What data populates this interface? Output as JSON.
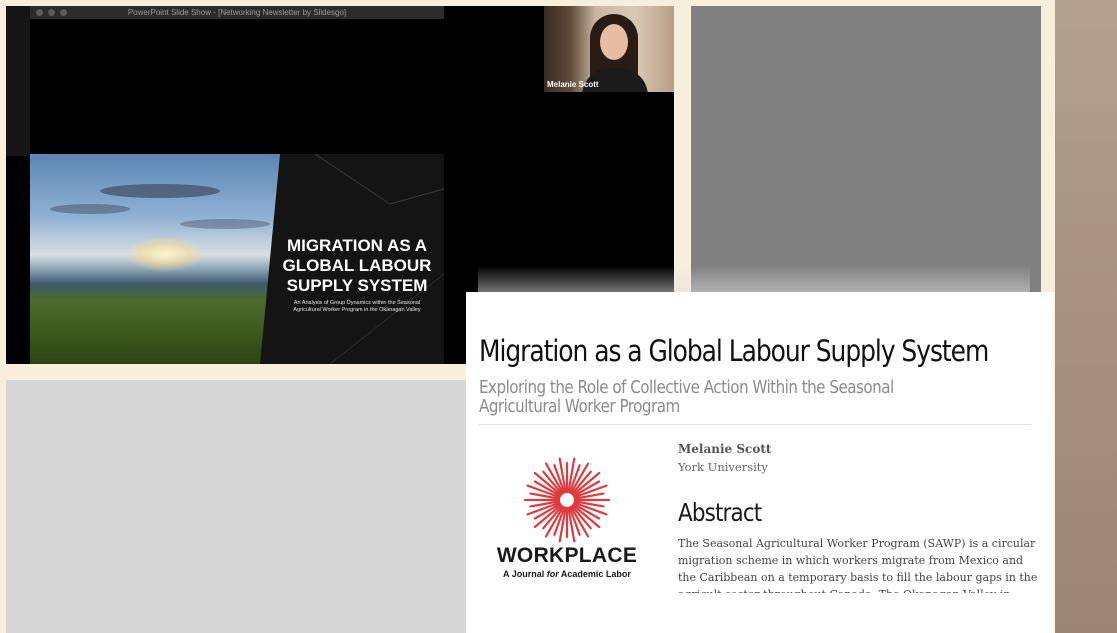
{
  "window": {
    "title": "PowerPoint Slide Show - [Networking Newsletter by Slidesgo]"
  },
  "slide": {
    "title_lines": [
      "MIGRATION AS A",
      "GLOBAL LABOUR",
      "SUPPLY SYSTEM"
    ],
    "subtitle": "An Analysis of Group Dynamics within the Seasonal Agricultural Worker Program in the Okanagan Valley"
  },
  "video": {
    "participant_name": "Melanie Scott"
  },
  "article": {
    "title": "Migration as a Global Labour Supply System",
    "subtitle": "Exploring the Role of Collective Action Within the Seasonal Agricultural Worker Program",
    "author": "Melanie Scott",
    "affiliation": "York University",
    "abstract_heading": "Abstract",
    "abstract_text": "The Seasonal Agricultural Worker Program (SAWP) is a circular migration scheme in which workers migrate from Mexico and the Caribbean on a temporary basis to fill the labour gaps in the agricult sector throughout Canada. The Okanagan Valley in British Columbia"
  },
  "logo": {
    "wordmark": "WORKPLACE",
    "tagline_pre": "A Journal ",
    "tagline_em": "for",
    "tagline_post": " Academic Labor",
    "color": "#e0393e"
  },
  "colors": {
    "accent_red": "#e0393e",
    "slide_bg": "#141414"
  }
}
